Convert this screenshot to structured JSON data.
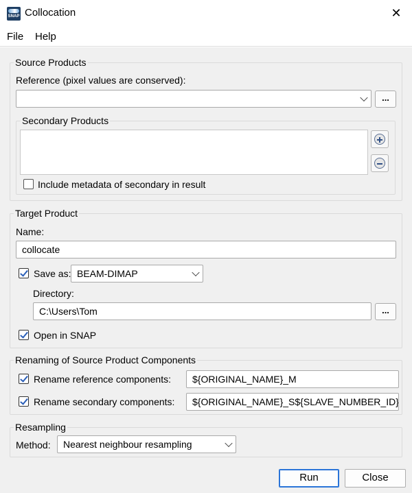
{
  "window": {
    "title": "Collocation",
    "icon_text": "SNAP",
    "close_glyph": "✕"
  },
  "menu": [
    "File",
    "Help"
  ],
  "source_products": {
    "group_title": "Source Products",
    "reference_label": "Reference (pixel values are conserved):",
    "reference_value": "",
    "browse_label": "...",
    "secondary": {
      "group_title": "Secondary Products",
      "include_metadata_label": "Include metadata of secondary in result",
      "include_metadata_checked": false
    }
  },
  "target_product": {
    "group_title": "Target Product",
    "name_label": "Name:",
    "name_value": "collocate",
    "save_as_label": "Save as:",
    "save_as_checked": true,
    "format_value": "BEAM-DIMAP",
    "directory_label": "Directory:",
    "directory_value": "C:\\Users\\Tom",
    "browse_label": "...",
    "open_in_snap_label": "Open in SNAP",
    "open_in_snap_checked": true
  },
  "renaming": {
    "group_title": "Renaming of Source Product Components",
    "reference_label": "Rename reference components:",
    "reference_checked": true,
    "reference_value": "${ORIGINAL_NAME}_M",
    "secondary_label": "Rename secondary components:",
    "secondary_checked": true,
    "secondary_value": "${ORIGINAL_NAME}_S${SLAVE_NUMBER_ID}"
  },
  "resampling": {
    "group_title": "Resampling",
    "method_label": "Method:",
    "method_value": "Nearest neighbour resampling"
  },
  "buttons": {
    "run": "Run",
    "close": "Close"
  },
  "colors": {
    "accent": "#2a74d8",
    "check": "#2b5fb8",
    "background": "#f0f0f0"
  }
}
